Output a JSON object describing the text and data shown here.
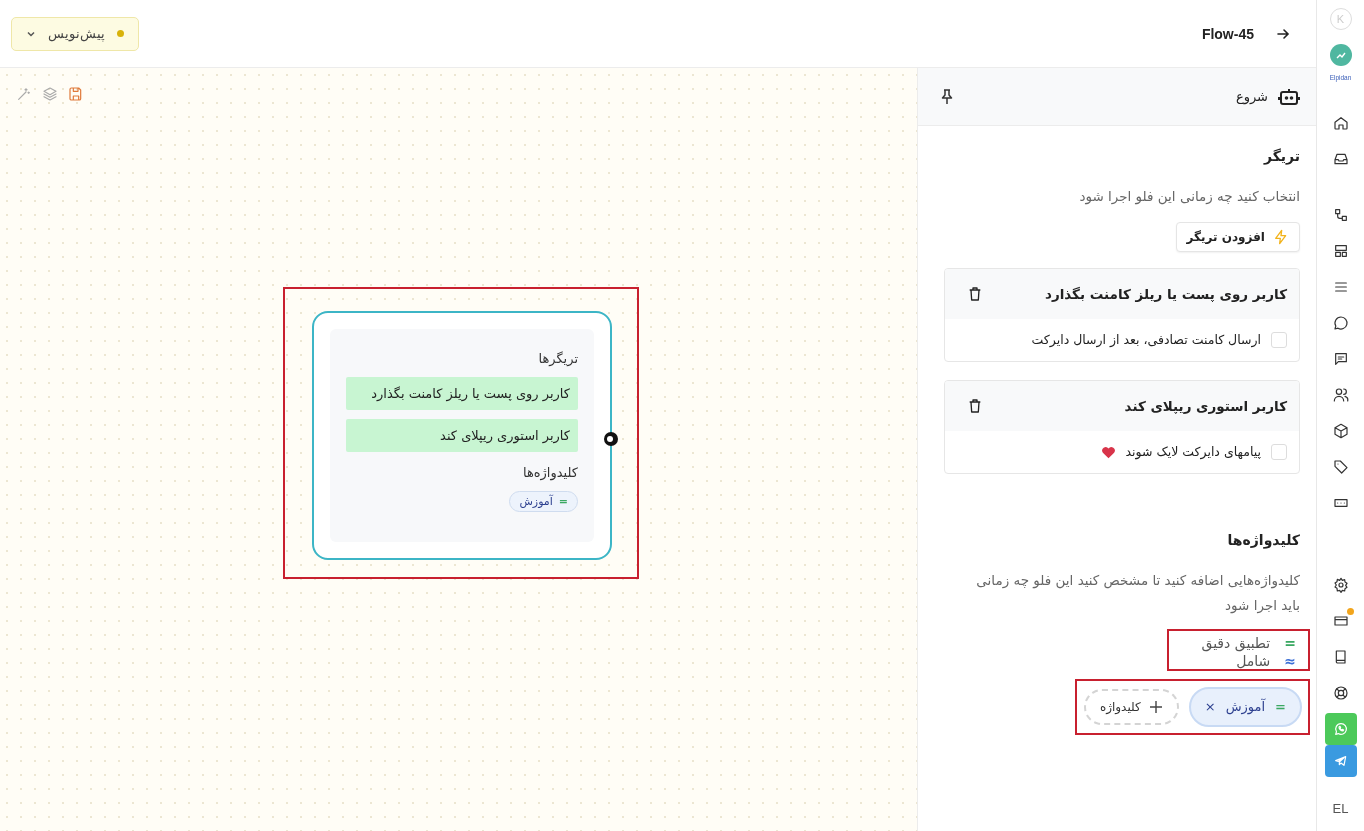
{
  "top_bar": {
    "flow_name": "Flow-45",
    "status": "پیش‌نویس"
  },
  "canvas": {
    "tools": [
      {
        "kind": "wand"
      },
      {
        "kind": "layers"
      },
      {
        "kind": "save"
      }
    ],
    "node": {
      "highlighted": true,
      "triggers_label": "تریگرها",
      "triggers": [
        "کاربر روی پست یا ریلز کامنت بگذارد",
        "کاربر استوری ریپلای کند"
      ],
      "keywords_label": "کلیدواژه‌ها",
      "keywords": [
        {
          "kind": "exact",
          "symbol": "=",
          "label": "آموزش"
        }
      ]
    }
  },
  "panel": {
    "title": "شروع",
    "trigger_section": {
      "title": "تریگر",
      "description": "انتخاب کنید چه زمانی این فلو اجرا شود",
      "add_button": "افزودن تریگر",
      "triggers": [
        {
          "title": "کاربر روی پست یا ریلز کامنت بگذارد",
          "option": {
            "label": "ارسال کامنت تصادفی، بعد از ارسال دایرکت",
            "checked": false,
            "heart": false
          }
        },
        {
          "title": "کاربر استوری ریپلای کند",
          "option": {
            "label": "پیامهای دایرکت لایک شوند",
            "checked": false,
            "heart": true
          }
        }
      ]
    },
    "keyword_section": {
      "title": "کلیدواژه‌ها",
      "description": "کلیدواژه‌هایی اضافه کنید تا مشخص کنید این فلو چه زمانی باید اجرا شود",
      "legend_highlighted": true,
      "match_modes": [
        {
          "kind": "exact",
          "symbol": "=",
          "label": "تطبیق دقیق"
        },
        {
          "kind": "contains",
          "symbol": "≈",
          "label": "شامل"
        }
      ],
      "chips_highlighted": true,
      "keywords": [
        {
          "kind": "exact",
          "symbol": "=",
          "label": "آموزش",
          "remove": "×"
        }
      ],
      "add_label": "کلیدواژه"
    }
  },
  "rail": {
    "logo": "K",
    "brand": "Elpidan",
    "language": "EL",
    "items": [
      {
        "kind": "home",
        "badge": false
      },
      {
        "kind": "inbox",
        "badge": false
      },
      {
        "kind": "flow",
        "badge": false
      },
      {
        "kind": "layout",
        "badge": false
      },
      {
        "kind": "list",
        "badge": false
      },
      {
        "kind": "chat",
        "badge": false
      },
      {
        "kind": "message",
        "badge": false
      },
      {
        "kind": "users",
        "badge": false
      },
      {
        "kind": "box",
        "badge": false
      },
      {
        "kind": "tag",
        "badge": false
      },
      {
        "kind": "keyboard",
        "badge": false
      },
      {
        "kind": "settings",
        "badge": false
      },
      {
        "kind": "card",
        "badge": true
      },
      {
        "kind": "book",
        "badge": false
      },
      {
        "kind": "lifebuoy",
        "badge": false
      },
      {
        "kind": "whatsapp",
        "badge": false
      },
      {
        "kind": "telegram",
        "badge": false
      }
    ]
  }
}
